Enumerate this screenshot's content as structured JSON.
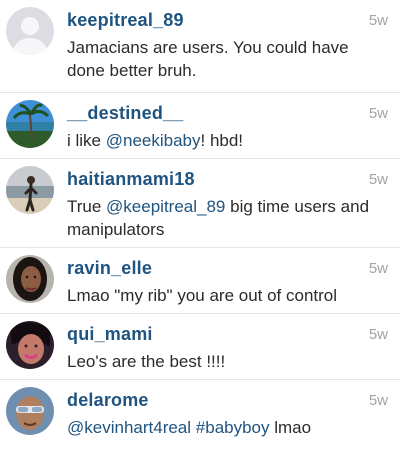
{
  "comments": [
    {
      "username": "keepitreal_89",
      "time": "5w",
      "text": "Jamacians are users. You could have done better bruh.",
      "avatar": "default-avatar-icon"
    },
    {
      "username": "__destined__",
      "time": "5w",
      "text_before": "i like ",
      "mention": "@neekibaby",
      "text_after": "! hbd!",
      "avatar": "beach-palm-photo"
    },
    {
      "username": "haitianmami18",
      "time": "5w",
      "text_before": "True ",
      "mention": "@keepitreal_89",
      "text_after": " big time users and manipulators",
      "avatar": "person-on-beach-photo"
    },
    {
      "username": "ravin_elle",
      "time": "5w",
      "text": "Lmao \"my rib\" you are out of control",
      "avatar": "woman-portrait-photo"
    },
    {
      "username": "qui_mami",
      "time": "5w",
      "text": "Leo's are the best !!!!",
      "avatar": "woman-selfie-photo"
    },
    {
      "username": "delarome",
      "time": "5w",
      "mention": "@kevinhart4real",
      "hashtag": "#babyboy",
      "text_after": " lmao",
      "avatar": "man-sunglasses-photo"
    }
  ],
  "colors": {
    "username": "#1f5480",
    "link": "#1f5480",
    "text": "#2b2b2b",
    "time": "#a4a4a4",
    "divider": "#e6e6e6"
  }
}
